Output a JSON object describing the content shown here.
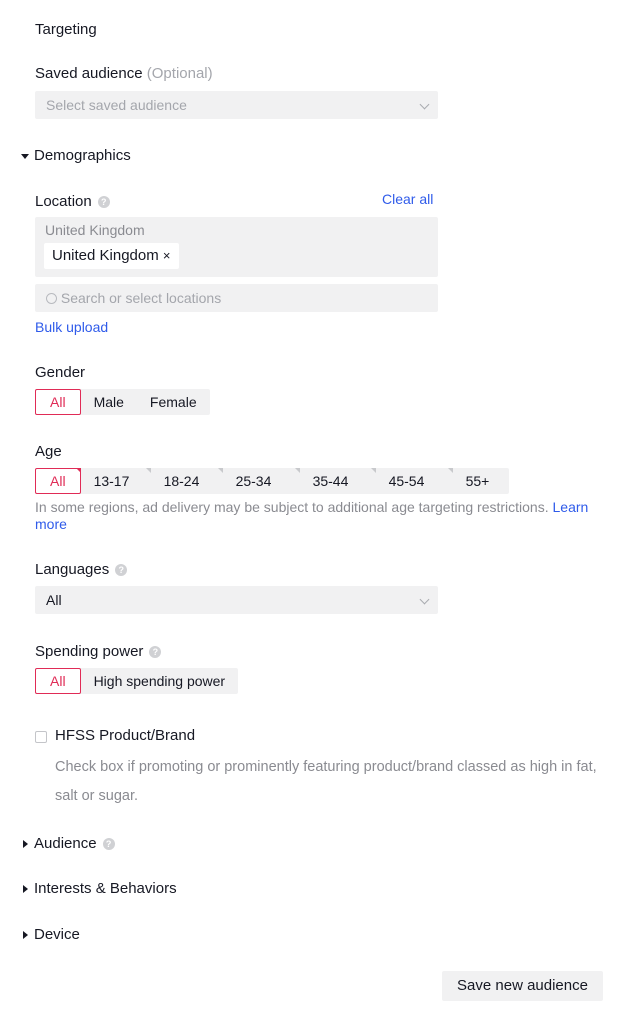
{
  "title": "Targeting",
  "saved_audience": {
    "label": "Saved audience",
    "optional": "(Optional)",
    "placeholder": "Select saved audience"
  },
  "demographics": {
    "label": "Demographics"
  },
  "location": {
    "label": "Location",
    "clear_all": "Clear all",
    "group_label": "United Kingdom",
    "tag": "United Kingdom",
    "tag_remove": "×",
    "search_placeholder": "Search or select locations",
    "bulk_upload": "Bulk upload"
  },
  "gender": {
    "label": "Gender",
    "options": [
      "All",
      "Male",
      "Female"
    ],
    "selected": "All"
  },
  "age": {
    "label": "Age",
    "options": [
      "All",
      "13-17",
      "18-24",
      "25-34",
      "35-44",
      "45-54",
      "55+"
    ],
    "selected": "All",
    "note": "In some regions, ad delivery may be subject to additional age targeting restrictions.",
    "learn_more": "Learn more"
  },
  "languages": {
    "label": "Languages",
    "value": "All"
  },
  "spending_power": {
    "label": "Spending power",
    "options": [
      "All",
      "High spending power"
    ],
    "selected": "All"
  },
  "hfss": {
    "label": "HFSS Product/Brand",
    "checked": false,
    "description": "Check box if promoting or prominently featuring product/brand classed as high in fat, salt or sugar."
  },
  "sections": {
    "audience": "Audience",
    "interests": "Interests & Behaviors",
    "device": "Device"
  },
  "save_button": "Save new audience",
  "colors": {
    "accent": "#e02b56",
    "link": "#2f5bea",
    "field_bg": "#f1f1f2"
  },
  "icons": {
    "help": "help-circle-icon",
    "expand": "caret-down-icon",
    "collapse": "caret-right-icon",
    "search": "search-icon",
    "dropdown": "chevron-down-icon"
  }
}
